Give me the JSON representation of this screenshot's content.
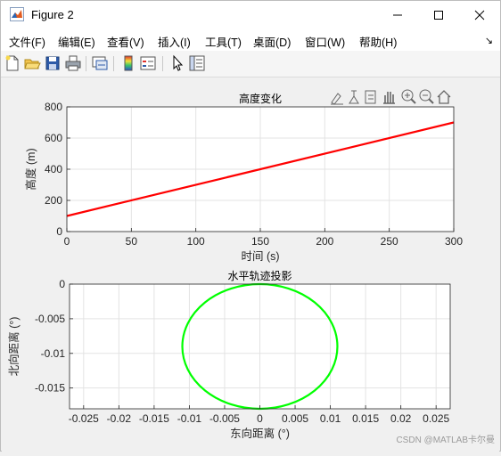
{
  "window": {
    "title": "Figure 2",
    "minimize_icon": "minimize-icon",
    "maximize_icon": "maximize-icon",
    "close_icon": "close-icon"
  },
  "menu": {
    "items": [
      "文件(F)",
      "编辑(E)",
      "查看(V)",
      "插入(I)",
      "工具(T)",
      "桌面(D)",
      "窗口(W)",
      "帮助(H)"
    ]
  },
  "toolbar": {
    "icons": [
      "new-figure-icon",
      "open-file-icon",
      "save-icon",
      "print-icon",
      "link-icon",
      "colorbar-icon",
      "legend-icon",
      "pointer-icon",
      "property-inspector-icon"
    ]
  },
  "axes_toolbar": {
    "icons": [
      "brush-icon",
      "data-tip-icon",
      "export-icon",
      "pan-icon",
      "zoom-in-icon",
      "zoom-out-icon",
      "home-icon"
    ]
  },
  "watermark": "CSDN @MATLAB卡尔曼",
  "colors": {
    "line1": "#ff0000",
    "line2": "#00ff00",
    "grid": "#e3e3e3"
  },
  "chart_data": [
    {
      "type": "line",
      "title": "高度变化",
      "xlabel": "时间 (s)",
      "ylabel": "高度 (m)",
      "xlim": [
        0,
        300
      ],
      "ylim": [
        0,
        800
      ],
      "xticks": [
        0,
        50,
        100,
        150,
        200,
        250,
        300
      ],
      "yticks": [
        0,
        200,
        400,
        600,
        800
      ],
      "grid": true,
      "series": [
        {
          "color": "#ff0000",
          "x": [
            0,
            300
          ],
          "y": [
            100,
            700
          ]
        }
      ]
    },
    {
      "type": "line",
      "title": "水平轨迹投影",
      "xlabel": "东向距离 (°)",
      "ylabel": "北向距离 (°)",
      "xlim": [
        -0.027,
        0.027
      ],
      "ylim": [
        -0.018,
        0
      ],
      "xticks": [
        -0.025,
        -0.02,
        -0.015,
        -0.01,
        -0.005,
        0,
        0.005,
        0.01,
        0.015,
        0.02,
        0.025
      ],
      "yticks": [
        0,
        -0.005,
        -0.01,
        -0.015
      ],
      "grid": true,
      "series": [
        {
          "color": "#00ff00",
          "shape": "ellipse",
          "center": [
            0,
            -0.009
          ],
          "radius_x": 0.011,
          "radius_y": 0.009
        }
      ]
    }
  ]
}
